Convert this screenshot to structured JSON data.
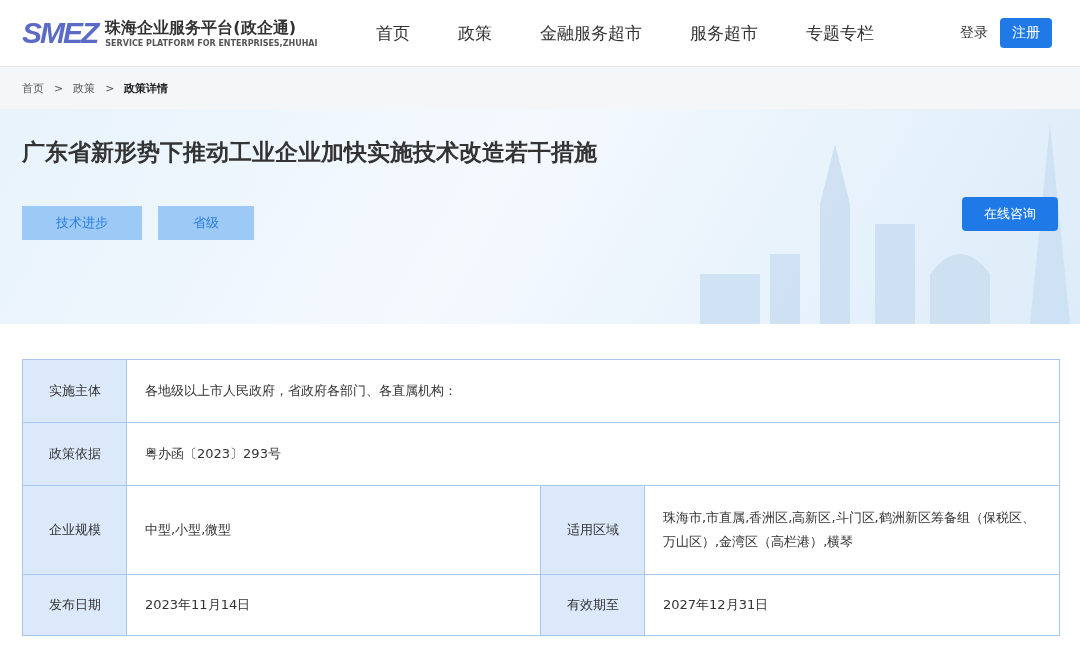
{
  "header": {
    "logo_mark": "SMEZ",
    "logo_title": "珠海企业服务平台(政企通)",
    "logo_subtitle": "SERVICE PLATFORM FOR ENTERPRISES,ZHUHAI",
    "nav": [
      "首页",
      "政策",
      "金融服务超市",
      "服务超市",
      "专题专栏"
    ],
    "login": "登录",
    "register": "注册"
  },
  "breadcrumb": [
    {
      "label": "首页",
      "current": false
    },
    {
      "label": "政策",
      "current": false
    },
    {
      "label": "政策详情",
      "current": true
    }
  ],
  "breadcrumb_separator": ">",
  "banner": {
    "title": "广东省新形势下推动工业企业加快实施技术改造若干措施",
    "tags": [
      "技术进步",
      "省级"
    ],
    "consult_button": "在线咨询"
  },
  "details": [
    [
      {
        "label": "实施主体",
        "value": "各地级以上市人民政府，省政府各部门、各直属机构："
      }
    ],
    [
      {
        "label": "政策依据",
        "value": "粤办函〔2023〕293号"
      }
    ],
    [
      {
        "label": "企业规模",
        "value": "中型,小型,微型"
      },
      {
        "label": "适用区域",
        "value": "珠海市,市直属,香洲区,高新区,斗门区,鹤洲新区筹备组（保税区、万山区）,金湾区（高栏港）,横琴"
      }
    ],
    [
      {
        "label": "发布日期",
        "value": "2023年11月14日"
      },
      {
        "label": "有效期至",
        "value": "2027年12月31日"
      }
    ]
  ]
}
